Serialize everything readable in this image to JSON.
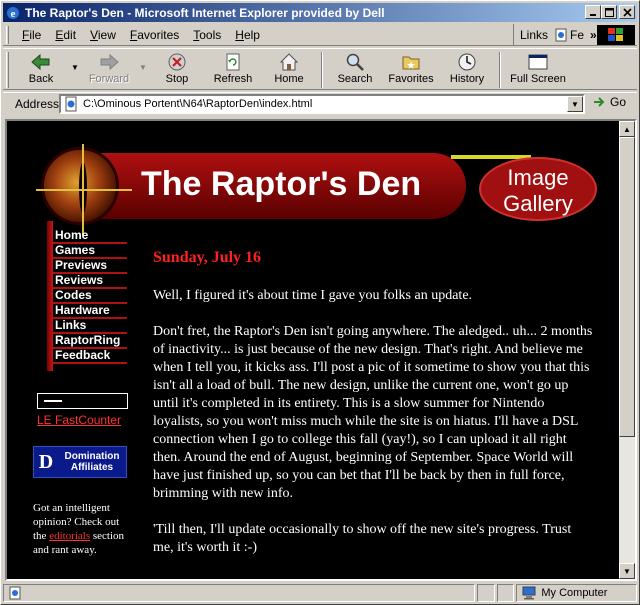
{
  "window": {
    "title": "The Raptor's Den - Microsoft Internet Explorer provided by Dell"
  },
  "menu": {
    "items": [
      {
        "key": "F",
        "rest": "ile"
      },
      {
        "key": "E",
        "rest": "dit"
      },
      {
        "key": "V",
        "rest": "iew"
      },
      {
        "key": "F",
        "rest": "avorites"
      },
      {
        "key": "T",
        "rest": "ools"
      },
      {
        "key": "H",
        "rest": "elp"
      }
    ],
    "links_label": "Links",
    "links_item": "Fe"
  },
  "toolbar": {
    "back": "Back",
    "forward": "Forward",
    "stop": "Stop",
    "refresh": "Refresh",
    "home": "Home",
    "search": "Search",
    "favorites": "Favorites",
    "history": "History",
    "fullscreen": "Full Screen"
  },
  "address": {
    "label": "Address",
    "url": "C:\\Ominous Portent\\N64\\RaptorDen\\index.html",
    "go": "Go"
  },
  "page": {
    "site_title": "The Raptor's Den",
    "gallery": [
      "Image",
      "Gallery"
    ],
    "nav": [
      "Home",
      "Games",
      "Previews",
      "Reviews",
      "Codes",
      "Hardware",
      "Links",
      "RaptorRing",
      "Feedback"
    ],
    "counter_link": "LE FastCounter",
    "domination": {
      "mark": "D",
      "line1": "Domination",
      "line2": "Affiliates"
    },
    "side_note_before": "Got an intelligent opinion? Check out the ",
    "side_note_link": "editorials",
    "side_note_after": " section and rant away.",
    "date": "Sunday, July 16",
    "paragraphs": [
      "Well, I figured it's about time I gave you folks an update.",
      "Don't fret, the Raptor's Den isn't going anywhere. The aledged.. uh... 2 months of inactivity... is just because of the new design. That's right. And believe me when I tell you, it kicks ass. I'll post a pic of it sometime to show you that this isn't all a load of bull. The new design, unlike the current one, won't go up until it's completed in its entirety. This is a slow summer for Nintendo loyalists, so you won't miss much while the site is on hiatus. I'll have a DSL connection when I go to college this fall (yay!), so I can upload it all right then. Around the end of August, beginning of September. Space World will have just finished up, so you can bet that I'll be back by then in full force, brimming with new info.",
      "'Till then, I'll update occasionally to show off the new site's progress. Trust me, it's worth it :-)"
    ]
  },
  "status": {
    "zone": "My Computer"
  }
}
